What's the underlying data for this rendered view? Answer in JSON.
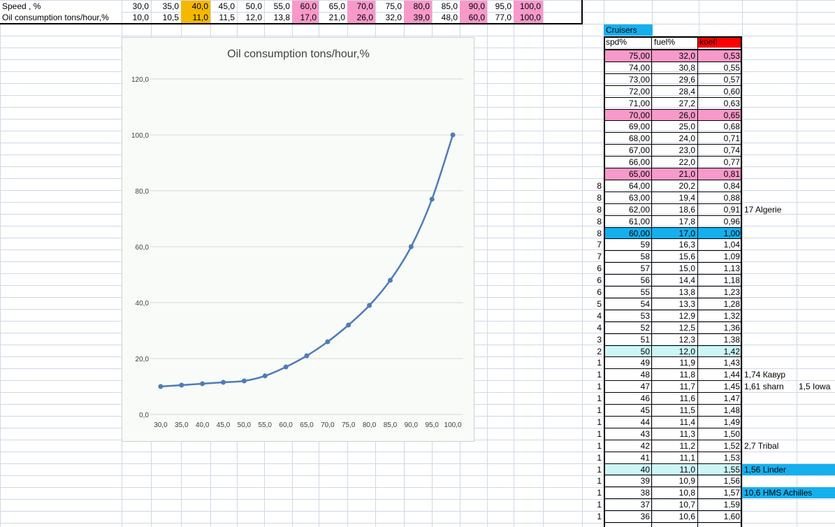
{
  "top_table": {
    "row1_label": "Speed , %",
    "row2_label": "Oil consumption tons/hour,%",
    "speed": [
      "30,0",
      "35,0",
      "40,0",
      "45,0",
      "50,0",
      "55,0",
      "60,0",
      "65,0",
      "70,0",
      "75,0",
      "80,0",
      "85,0",
      "90,0",
      "95,0",
      "100,0"
    ],
    "oil": [
      "10,0",
      "10,5",
      "11,0",
      "11,5",
      "12,0",
      "13,8",
      "17,0",
      "21,0",
      "26,0",
      "32,0",
      "39,0",
      "48,0",
      "60,0",
      "77,0",
      "100,0"
    ],
    "highlight": [
      "none",
      "none",
      "orange",
      "none",
      "none",
      "none",
      "pink",
      "none",
      "pink",
      "none",
      "pink",
      "none",
      "pink",
      "none",
      "pink"
    ]
  },
  "colors": {
    "orange": "#f5b800",
    "pink": "#f799c9",
    "blue": "#14b0ee",
    "lightcyan": "#ccf6f6",
    "red": "#ff0000",
    "series": "#4f7bb8",
    "grid": "#d0d7e5"
  },
  "chart_data": {
    "type": "line",
    "title": "Oil consumption tons/hour,%",
    "x": [
      "30,0",
      "35,0",
      "40,0",
      "45,0",
      "50,0",
      "55,0",
      "60,0",
      "65,0",
      "70,0",
      "75,0",
      "80,0",
      "85,0",
      "90,0",
      "95,0",
      "100,0"
    ],
    "series": [
      {
        "values": [
          10.0,
          10.5,
          11.0,
          11.5,
          12.0,
          13.8,
          17.0,
          21.0,
          26.0,
          32.0,
          39.0,
          48.0,
          60.0,
          77.0,
          100.0
        ]
      }
    ],
    "yticks": [
      "0,0",
      "20,0",
      "40,0",
      "60,0",
      "80,0",
      "100,0",
      "120,0"
    ],
    "ylim": [
      0,
      120
    ],
    "grid": true
  },
  "cruisers": {
    "title": "Cruisers",
    "headers": [
      "spd%",
      "fuel%",
      "koef!"
    ],
    "rows": [
      {
        "n": "",
        "spd": "75,00",
        "fuel": "32,0",
        "koef": "0,53",
        "hl": "pink",
        "note": "",
        "note2": "",
        "note_hl": ""
      },
      {
        "n": "",
        "spd": "74,00",
        "fuel": "30,8",
        "koef": "0,55",
        "hl": "",
        "note": "",
        "note2": "",
        "note_hl": ""
      },
      {
        "n": "",
        "spd": "73,00",
        "fuel": "29,6",
        "koef": "0,57",
        "hl": "",
        "note": "",
        "note2": "",
        "note_hl": ""
      },
      {
        "n": "",
        "spd": "72,00",
        "fuel": "28,4",
        "koef": "0,60",
        "hl": "",
        "note": "",
        "note2": "",
        "note_hl": ""
      },
      {
        "n": "",
        "spd": "71,00",
        "fuel": "27,2",
        "koef": "0,63",
        "hl": "",
        "note": "",
        "note2": "",
        "note_hl": ""
      },
      {
        "n": "",
        "spd": "70,00",
        "fuel": "26,0",
        "koef": "0,65",
        "hl": "pink",
        "note": "",
        "note2": "",
        "note_hl": ""
      },
      {
        "n": "",
        "spd": "69,00",
        "fuel": "25,0",
        "koef": "0,68",
        "hl": "",
        "note": "",
        "note2": "",
        "note_hl": ""
      },
      {
        "n": "",
        "spd": "68,00",
        "fuel": "24,0",
        "koef": "0,71",
        "hl": "",
        "note": "",
        "note2": "",
        "note_hl": ""
      },
      {
        "n": "",
        "spd": "67,00",
        "fuel": "23,0",
        "koef": "0,74",
        "hl": "",
        "note": "",
        "note2": "",
        "note_hl": ""
      },
      {
        "n": "",
        "spd": "66,00",
        "fuel": "22,0",
        "koef": "0,77",
        "hl": "",
        "note": "",
        "note2": "",
        "note_hl": ""
      },
      {
        "n": "",
        "spd": "65,00",
        "fuel": "21,0",
        "koef": "0,81",
        "hl": "pink",
        "note": "",
        "note2": "",
        "note_hl": ""
      },
      {
        "n": "8",
        "spd": "64,00",
        "fuel": "20,2",
        "koef": "0,84",
        "hl": "",
        "note": "",
        "note2": "",
        "note_hl": ""
      },
      {
        "n": "8",
        "spd": "63,00",
        "fuel": "19,4",
        "koef": "0,88",
        "hl": "",
        "note": "",
        "note2": "",
        "note_hl": ""
      },
      {
        "n": "8",
        "spd": "62,00",
        "fuel": "18,6",
        "koef": "0,91",
        "hl": "",
        "note": "17 Algerie",
        "note2": "",
        "note_hl": ""
      },
      {
        "n": "8",
        "spd": "61,00",
        "fuel": "17,8",
        "koef": "0,96",
        "hl": "",
        "note": "",
        "note2": "",
        "note_hl": ""
      },
      {
        "n": "8",
        "spd": "60,00",
        "fuel": "17,0",
        "koef": "1,00",
        "hl": "blue",
        "note": "",
        "note2": "",
        "note_hl": ""
      },
      {
        "n": "7",
        "spd": "59",
        "fuel": "16,3",
        "koef": "1,04",
        "hl": "",
        "note": "",
        "note2": "",
        "note_hl": ""
      },
      {
        "n": "7",
        "spd": "58",
        "fuel": "15,6",
        "koef": "1,09",
        "hl": "",
        "note": "",
        "note2": "",
        "note_hl": ""
      },
      {
        "n": "6",
        "spd": "57",
        "fuel": "15,0",
        "koef": "1,13",
        "hl": "",
        "note": "",
        "note2": "",
        "note_hl": ""
      },
      {
        "n": "6",
        "spd": "56",
        "fuel": "14,4",
        "koef": "1,18",
        "hl": "",
        "note": "",
        "note2": "",
        "note_hl": ""
      },
      {
        "n": "6",
        "spd": "55",
        "fuel": "13,8",
        "koef": "1,23",
        "hl": "",
        "note": "",
        "note2": "",
        "note_hl": ""
      },
      {
        "n": "5",
        "spd": "54",
        "fuel": "13,3",
        "koef": "1,28",
        "hl": "",
        "note": "",
        "note2": "",
        "note_hl": ""
      },
      {
        "n": "4",
        "spd": "53",
        "fuel": "12,9",
        "koef": "1,32",
        "hl": "",
        "note": "",
        "note2": "",
        "note_hl": ""
      },
      {
        "n": "4",
        "spd": "52",
        "fuel": "12,5",
        "koef": "1,36",
        "hl": "",
        "note": "",
        "note2": "",
        "note_hl": ""
      },
      {
        "n": "3",
        "spd": "51",
        "fuel": "12,3",
        "koef": "1,38",
        "hl": "",
        "note": "",
        "note2": "",
        "note_hl": ""
      },
      {
        "n": "2",
        "spd": "50",
        "fuel": "12,0",
        "koef": "1,42",
        "hl": "lightcyan",
        "note": "",
        "note2": "",
        "note_hl": ""
      },
      {
        "n": "1",
        "spd": "49",
        "fuel": "11,9",
        "koef": "1,43",
        "hl": "",
        "note": "",
        "note2": "",
        "note_hl": ""
      },
      {
        "n": "1",
        "spd": "48",
        "fuel": "11,8",
        "koef": "1,44",
        "hl": "",
        "note": "1,74 Кавур",
        "note2": "",
        "note_hl": ""
      },
      {
        "n": "1",
        "spd": "47",
        "fuel": "11,7",
        "koef": "1,45",
        "hl": "",
        "note": "1,61 sharn",
        "note2": "1,5 Iowa",
        "note_hl": ""
      },
      {
        "n": "1",
        "spd": "46",
        "fuel": "11,6",
        "koef": "1,47",
        "hl": "",
        "note": "",
        "note2": "",
        "note_hl": ""
      },
      {
        "n": "1",
        "spd": "45",
        "fuel": "11,5",
        "koef": "1,48",
        "hl": "",
        "note": "",
        "note2": "",
        "note_hl": ""
      },
      {
        "n": "1",
        "spd": "44",
        "fuel": "11,4",
        "koef": "1,49",
        "hl": "",
        "note": "",
        "note2": "",
        "note_hl": ""
      },
      {
        "n": "1",
        "spd": "43",
        "fuel": "11,3",
        "koef": "1,50",
        "hl": "",
        "note": "",
        "note2": "",
        "note_hl": ""
      },
      {
        "n": "1",
        "spd": "42",
        "fuel": "11,2",
        "koef": "1,52",
        "hl": "",
        "note": "2,7 Tribal",
        "note2": "",
        "note_hl": ""
      },
      {
        "n": "1",
        "spd": "41",
        "fuel": "11,1",
        "koef": "1,53",
        "hl": "",
        "note": "",
        "note2": "",
        "note_hl": ""
      },
      {
        "n": "1",
        "spd": "40",
        "fuel": "11,0",
        "koef": "1,55",
        "hl": "lightcyan",
        "note": "1,56 Linder",
        "note2": "",
        "note_hl": "blue"
      },
      {
        "n": "1",
        "spd": "39",
        "fuel": "10,9",
        "koef": "1,56",
        "hl": "",
        "note": "",
        "note2": "",
        "note_hl": ""
      },
      {
        "n": "1",
        "spd": "38",
        "fuel": "10,8",
        "koef": "1,57",
        "hl": "",
        "note": "10,6 HMS Achilles",
        "note2": "",
        "note_hl": "blue"
      },
      {
        "n": "1",
        "spd": "37",
        "fuel": "10,7",
        "koef": "1,59",
        "hl": "",
        "note": "",
        "note2": "",
        "note_hl": ""
      },
      {
        "n": "1",
        "spd": "36",
        "fuel": "10,6",
        "koef": "1,60",
        "hl": "",
        "note": "",
        "note2": "",
        "note_hl": ""
      }
    ]
  }
}
